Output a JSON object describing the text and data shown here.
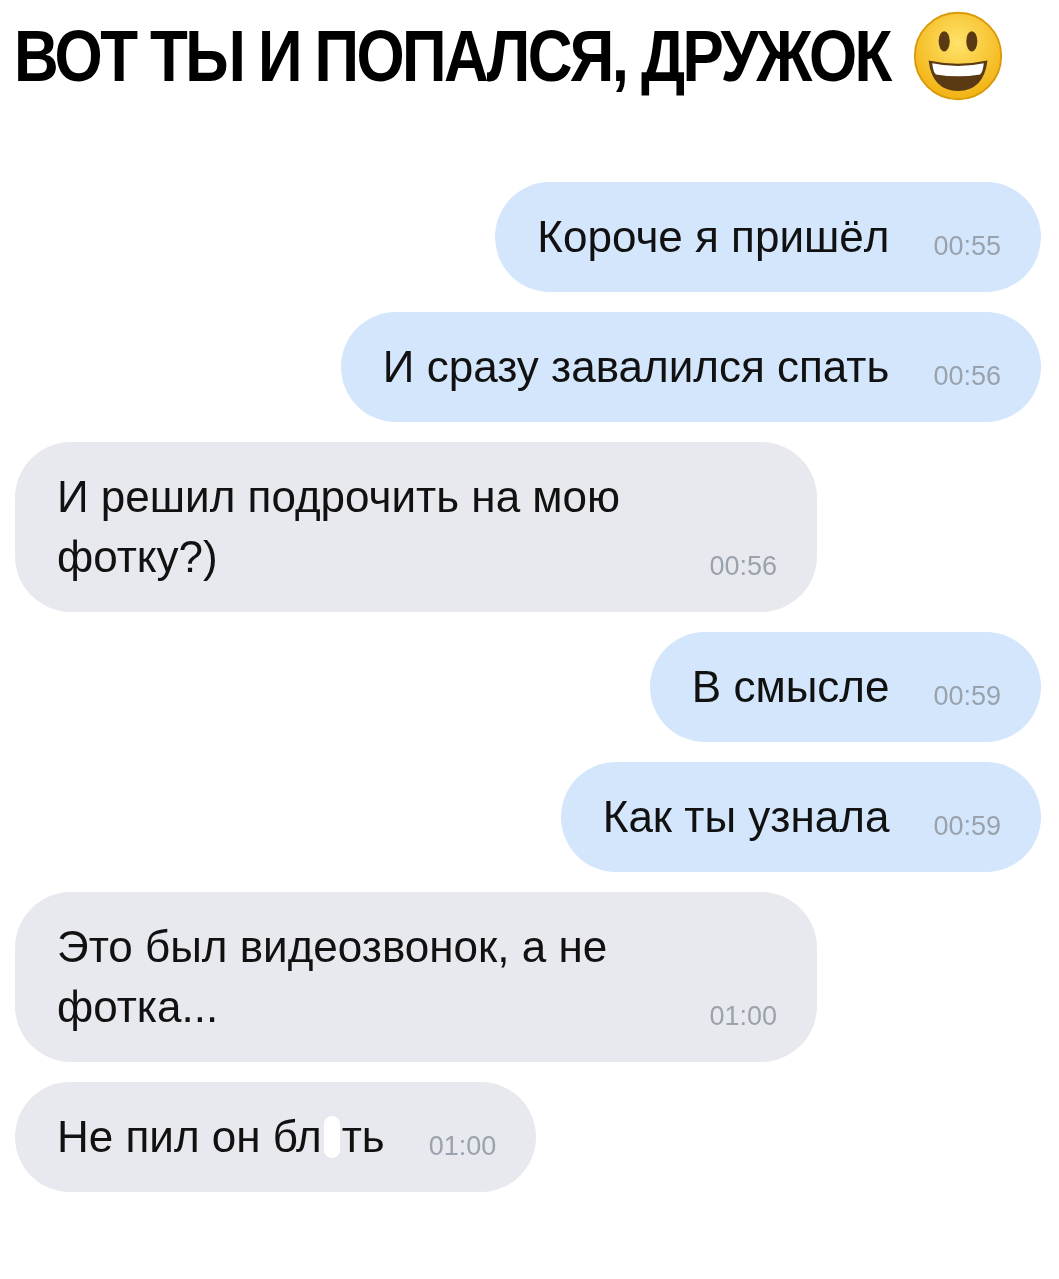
{
  "caption": {
    "title": "ВОТ ТЫ И ПОПАЛСЯ, ДРУЖОК"
  },
  "messages": [
    {
      "kind": "outgoing",
      "text": "Короче я пришёл",
      "time": "00:55"
    },
    {
      "kind": "outgoing",
      "text": "И сразу завалился спать",
      "time": "00:56"
    },
    {
      "kind": "incoming",
      "text": "И решил подрочить на мою фотку?)",
      "time": "00:56"
    },
    {
      "kind": "outgoing",
      "text": "В смысле",
      "time": "00:59"
    },
    {
      "kind": "outgoing",
      "text": "Как ты узнала",
      "time": "00:59"
    },
    {
      "kind": "incoming",
      "text": "Это был видеозвонок, а не фотка...",
      "time": "01:00"
    },
    {
      "kind": "incoming",
      "text": "Не пил он бл",
      "censored": true,
      "text_after": "ть",
      "time": "01:00"
    }
  ]
}
